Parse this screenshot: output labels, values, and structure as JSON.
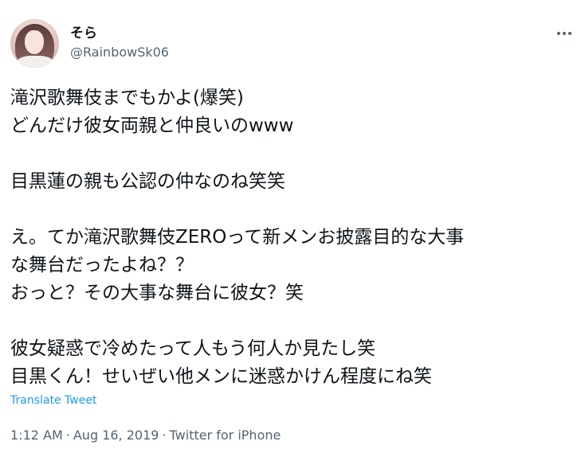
{
  "user": {
    "display_name": "そら",
    "handle": "@RainbowSk06"
  },
  "tweet": {
    "lines": [
      "滝沢歌舞伎までもかよ(爆笑)",
      "どんだけ彼女両親と仲良いのwww",
      "",
      "目黒蓮の親も公認の仲なのね笑笑",
      "",
      "え。てか滝沢歌舞伎ZEROって新メンお披露目的な大事",
      "な舞台だったよね？？",
      "おっと？その大事な舞台に彼女？笑",
      "",
      "彼女疑惑で冷めたって人もう何人か見たし笑",
      "目黒くん！せいぜい他メンに迷惑かけん程度にね笑"
    ],
    "translate_label": "Translate Tweet",
    "time": "1:12 AM",
    "date": "Aug 16, 2019",
    "source": "Twitter for iPhone",
    "separator": "·"
  },
  "icons": {
    "more": "more-horizontal-icon",
    "avatar": "profile-photo"
  },
  "colors": {
    "text": "#0f1419",
    "secondary": "#536471",
    "link": "#1d9bf0"
  }
}
